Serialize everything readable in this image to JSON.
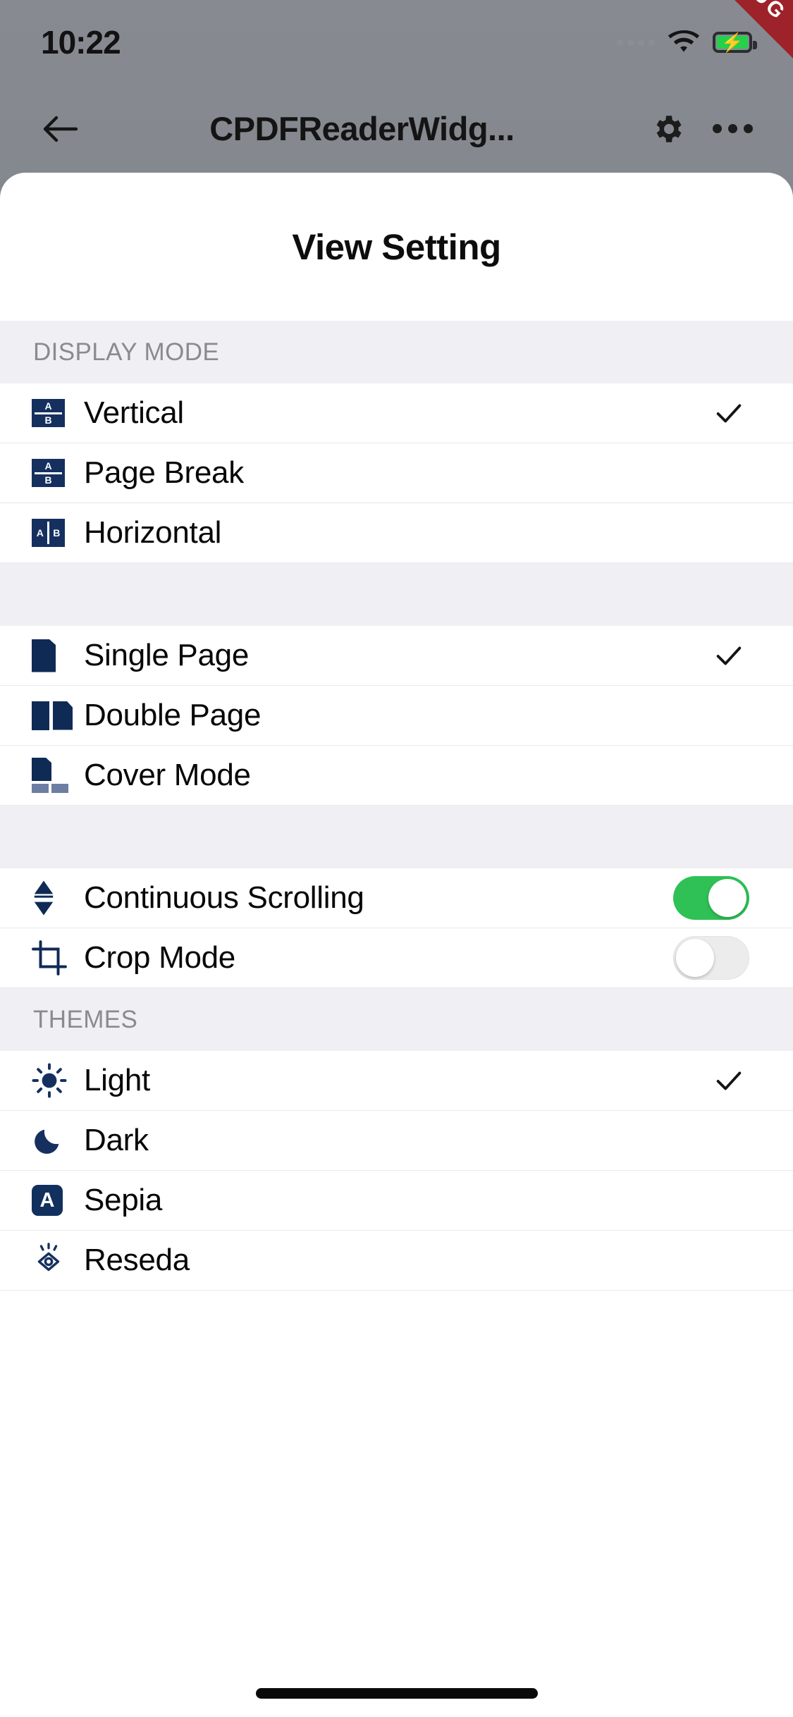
{
  "status_bar": {
    "time": "10:22",
    "wifi_icon": "wifi-icon",
    "battery_icon": "battery-charging-icon",
    "signal_icon": "signal-dots-icon",
    "debug_ribbon": "DEBUG"
  },
  "app_bar": {
    "back_icon": "back-arrow-icon",
    "title": "CPDFReaderWidg...",
    "settings_icon": "gear-icon",
    "more_icon": "more-options-icon"
  },
  "sheet": {
    "title": "View Setting",
    "sections": [
      {
        "header": "DISPLAY MODE",
        "rows": [
          {
            "label": "Vertical",
            "icon": "page-vertical-icon",
            "checked": true
          },
          {
            "label": "Page Break",
            "icon": "page-break-icon",
            "checked": false
          },
          {
            "label": "Horizontal",
            "icon": "page-horizontal-icon",
            "checked": false
          }
        ]
      },
      {
        "header": "",
        "rows": [
          {
            "label": "Single Page",
            "icon": "single-page-icon",
            "checked": true
          },
          {
            "label": "Double Page",
            "icon": "double-page-icon",
            "checked": false
          },
          {
            "label": "Cover Mode",
            "icon": "cover-mode-icon",
            "checked": false
          }
        ]
      },
      {
        "header": "",
        "rows": [
          {
            "label": "Continuous Scrolling",
            "icon": "updown-arrows-icon",
            "toggle": "on"
          },
          {
            "label": "Crop Mode",
            "icon": "crop-icon",
            "toggle": "off"
          }
        ]
      },
      {
        "header": "THEMES",
        "rows": [
          {
            "label": "Light",
            "icon": "sun-icon",
            "checked": true
          },
          {
            "label": "Dark",
            "icon": "moon-icon",
            "checked": false
          },
          {
            "label": "Sepia",
            "icon": "sepia-a-icon",
            "checked": false
          },
          {
            "label": "Reseda",
            "icon": "eye-icon",
            "checked": false
          }
        ]
      }
    ]
  },
  "colors": {
    "accent_navy": "#15305f",
    "toggle_on": "#2fc155",
    "toggle_off": "#ececed",
    "section_band": "#f0f0f4",
    "debug_ribbon": "#9d2229",
    "battery_green": "#25d04a"
  },
  "home_indicator": "home-indicator"
}
